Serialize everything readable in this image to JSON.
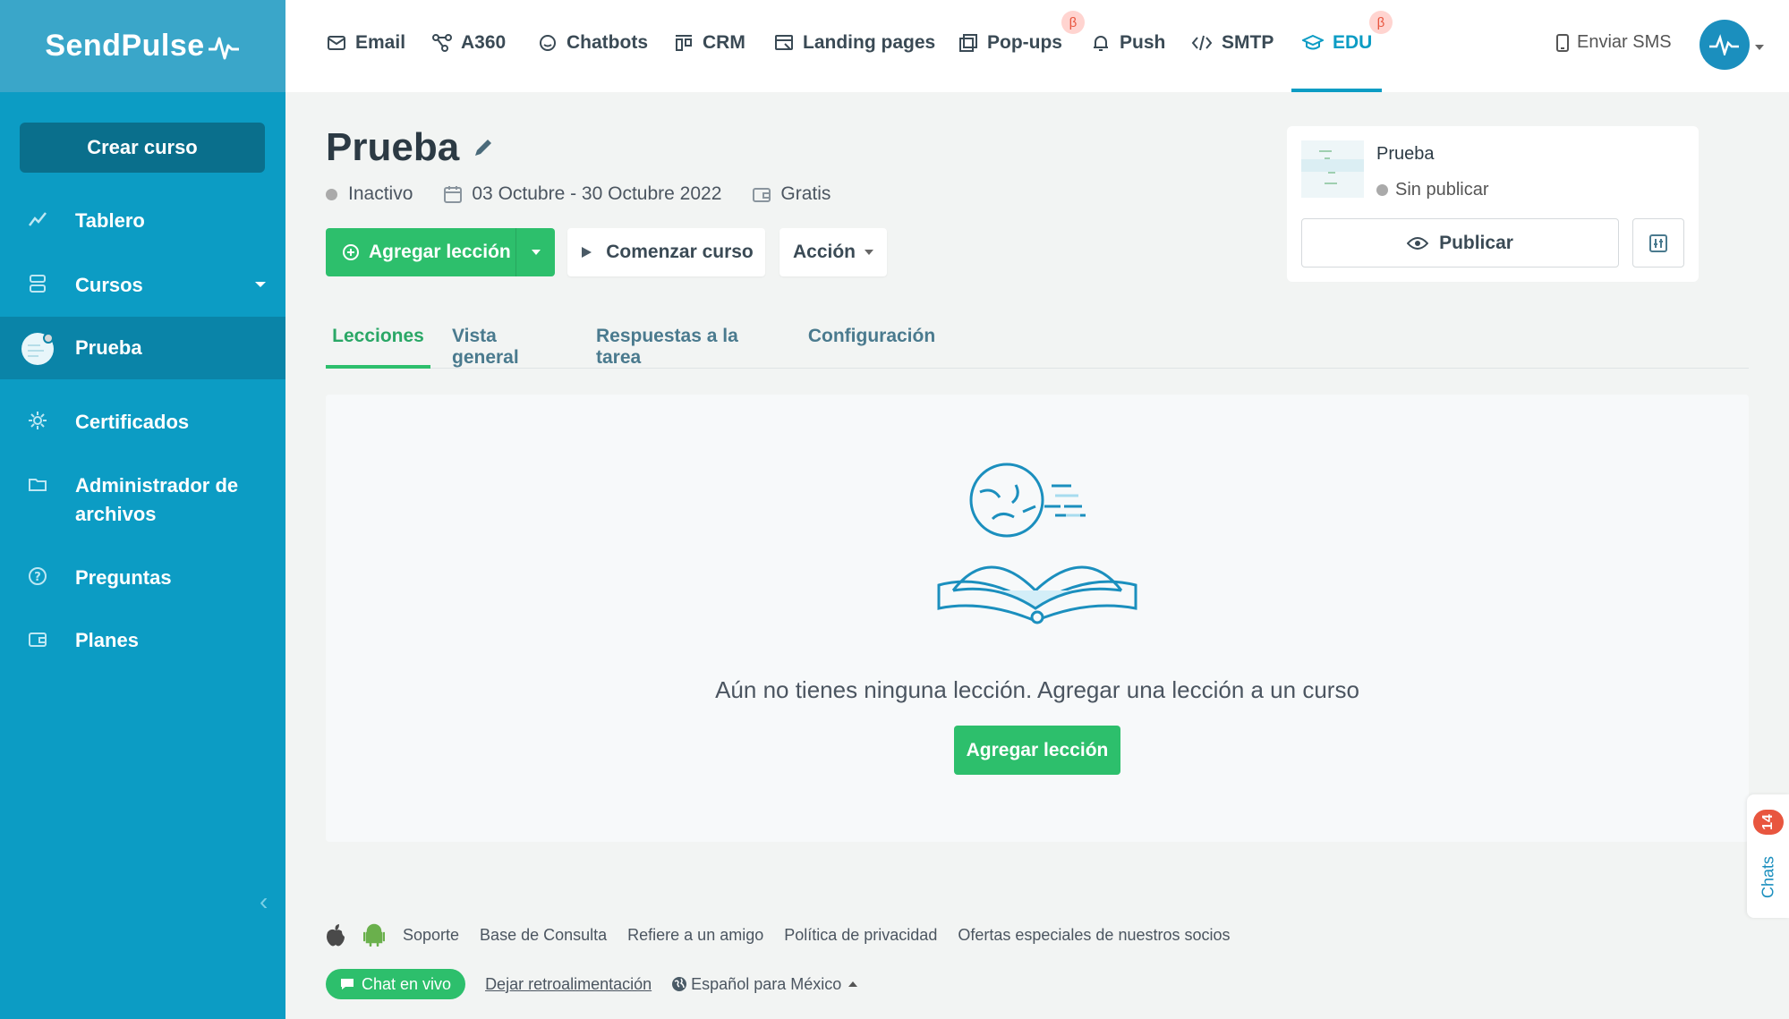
{
  "brand": {
    "name": "SendPulse",
    "primary_color": "#0c9cc4",
    "accent_green": "#2dbf6c"
  },
  "topnav": {
    "items": [
      {
        "label": "Email",
        "icon": "mail-icon"
      },
      {
        "label": "A360",
        "icon": "flow-icon"
      },
      {
        "label": "Chatbots",
        "icon": "chat-bubble-icon"
      },
      {
        "label": "CRM",
        "icon": "kanban-icon"
      },
      {
        "label": "Landing pages",
        "icon": "landing-page-icon"
      },
      {
        "label": "Pop-ups",
        "icon": "popup-icon"
      },
      {
        "label": "Push",
        "icon": "bell-icon"
      },
      {
        "label": "SMTP",
        "icon": "code-icon"
      },
      {
        "label": "EDU",
        "icon": "graduation-cap-icon"
      }
    ],
    "beta_symbol": "β",
    "active": "EDU",
    "sms_label": "Enviar SMS"
  },
  "sidebar": {
    "create_button": "Crear curso",
    "items": [
      {
        "label": "Tablero",
        "icon": "chart-line-icon"
      },
      {
        "label": "Cursos",
        "icon": "stack-icon"
      },
      {
        "label": "Prueba",
        "icon": "course-avatar-icon"
      },
      {
        "label": "Certificados",
        "icon": "gear-icon"
      },
      {
        "label": "Administrador de",
        "label2": "archivos",
        "icon": "folder-icon"
      },
      {
        "label": "Preguntas",
        "icon": "question-icon"
      },
      {
        "label": "Planes",
        "icon": "wallet-icon"
      }
    ]
  },
  "course": {
    "title": "Prueba",
    "status": "Inactivo",
    "dates": "03 Octubre - 30 Octubre 2022",
    "price": "Gratis"
  },
  "actions": {
    "add_lesson": "Agregar lección",
    "start_course": "Comenzar curso",
    "action": "Acción"
  },
  "publish_card": {
    "name": "Prueba",
    "status": "Sin publicar",
    "publish_button": "Publicar"
  },
  "tabs": [
    {
      "label": "Lecciones",
      "active": true
    },
    {
      "label": "Vista general",
      "active": false
    },
    {
      "label": "Respuestas a la tarea",
      "active": false
    },
    {
      "label": "Configuración",
      "active": false
    }
  ],
  "empty_state": {
    "message": "Aún no tienes ninguna lección. Agregar una lección a un curso",
    "button": "Agregar lección"
  },
  "chats_widget": {
    "label": "Chats",
    "count": "14"
  },
  "footer": {
    "links": [
      "Soporte",
      "Base de Consulta",
      "Refiere a un amigo",
      "Política de privacidad",
      "Ofertas especiales de nuestros socios"
    ],
    "live_chat": "Chat en vivo",
    "feedback": "Dejar retroalimentación",
    "language": "Español para México"
  }
}
